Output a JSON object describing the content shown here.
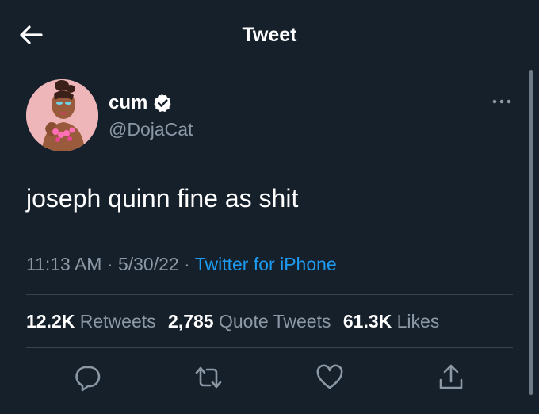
{
  "header": {
    "title": "Tweet"
  },
  "author": {
    "display_name": "cum",
    "handle": "@DojaCat",
    "verified": true
  },
  "tweet": {
    "text": "joseph quinn fine as shit",
    "time": "11:13 AM",
    "separator": "·",
    "date": "5/30/22",
    "source": "Twitter for iPhone"
  },
  "stats": {
    "retweets_count": "12.2K",
    "retweets_label": "Retweets",
    "quotes_count": "2,785",
    "quotes_label": "Quote Tweets",
    "likes_count": "61.3K",
    "likes_label": "Likes"
  },
  "icons": [
    "back-arrow-icon",
    "verified-badge-icon",
    "more-icon",
    "reply-icon",
    "retweet-icon",
    "like-icon",
    "share-icon"
  ],
  "colors": {
    "background": "#15202b",
    "text": "#ffffff",
    "secondary": "#8b98a5",
    "accent": "#1d9bf0",
    "divider": "#38444d"
  }
}
